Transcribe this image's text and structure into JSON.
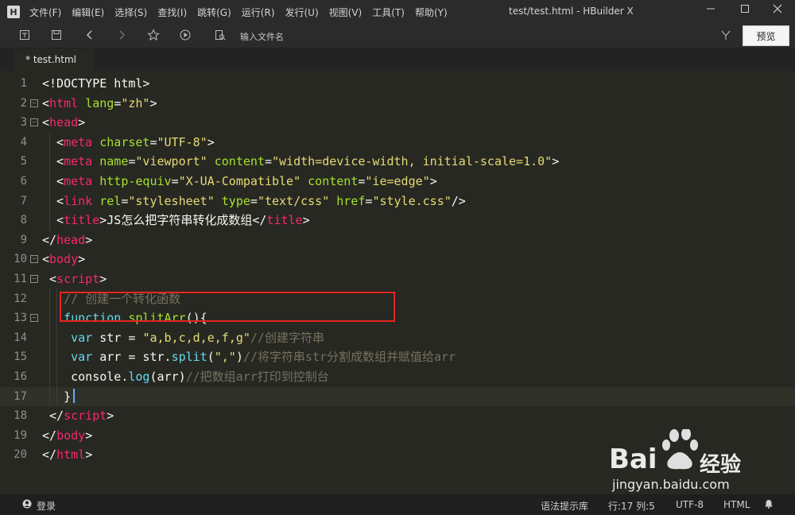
{
  "window": {
    "title": "test/test.html - HBuilder X",
    "logo": "H"
  },
  "menu": [
    {
      "label": "文件(F)"
    },
    {
      "label": "编辑(E)"
    },
    {
      "label": "选择(S)"
    },
    {
      "label": "查找(I)"
    },
    {
      "label": "跳转(G)"
    },
    {
      "label": "运行(R)"
    },
    {
      "label": "发行(U)"
    },
    {
      "label": "视图(V)"
    },
    {
      "label": "工具(T)"
    },
    {
      "label": "帮助(Y)"
    }
  ],
  "toolbar": {
    "search_placeholder": "输入文件名",
    "preview_label": "预览"
  },
  "tabs": [
    {
      "label": "* test.html"
    }
  ],
  "editor": {
    "lines": [
      {
        "num": "1"
      },
      {
        "num": "2"
      },
      {
        "num": "3"
      },
      {
        "num": "4"
      },
      {
        "num": "5"
      },
      {
        "num": "6"
      },
      {
        "num": "7"
      },
      {
        "num": "8"
      },
      {
        "num": "9"
      },
      {
        "num": "10"
      },
      {
        "num": "11"
      },
      {
        "num": "12"
      },
      {
        "num": "13"
      },
      {
        "num": "14"
      },
      {
        "num": "15"
      },
      {
        "num": "16"
      },
      {
        "num": "17"
      },
      {
        "num": "18"
      },
      {
        "num": "19"
      },
      {
        "num": "20"
      }
    ],
    "tokens": {
      "l1": [
        "<!DOCTYPE html>"
      ],
      "l2": [
        "<",
        "html",
        " ",
        "lang",
        "=",
        "\"zh\"",
        ">"
      ],
      "l3": [
        "<",
        "head",
        ">"
      ],
      "l4": [
        "  <",
        "meta",
        " ",
        "charset",
        "=",
        "\"UTF-8\"",
        ">"
      ],
      "l5": [
        "  <",
        "meta",
        " ",
        "name",
        "=",
        "\"viewport\"",
        " ",
        "content",
        "=",
        "\"width=device-width, initial-scale=1.0\"",
        ">"
      ],
      "l6": [
        "  <",
        "meta",
        " ",
        "http-equiv",
        "=",
        "\"X-UA-Compatible\"",
        " ",
        "content",
        "=",
        "\"ie=edge\"",
        ">"
      ],
      "l7": [
        "  <",
        "link",
        " ",
        "rel",
        "=",
        "\"stylesheet\"",
        " ",
        "type",
        "=",
        "\"text/css\"",
        " ",
        "href",
        "=",
        "\"style.css\"",
        "/>"
      ],
      "l8": [
        "  <",
        "title",
        ">",
        "JS怎么把字符串转化成数组",
        "</",
        "title",
        ">"
      ],
      "l9": [
        "</",
        "head",
        ">"
      ],
      "l10": [
        "<",
        "body",
        ">"
      ],
      "l11": [
        " <",
        "script",
        ">"
      ],
      "l12": [
        "   // 创建一个转化函数"
      ],
      "l13": [
        "   ",
        "function",
        " ",
        "splitArr",
        "(){"
      ],
      "l14": [
        "    ",
        "var",
        " str = ",
        "\"a,b,c,d,e,f,g\"",
        "//创建字符串"
      ],
      "l15": [
        "    ",
        "var",
        " arr = str.",
        "split",
        "(",
        "\",\"",
        ")",
        "//将字符串str分割成数组并赋值给arr"
      ],
      "l16": [
        "    console.",
        "log",
        "(arr)",
        "//把数组arr打印到控制台"
      ],
      "l17": [
        "   }"
      ],
      "l18": [
        " </",
        "script",
        ">"
      ],
      "l19": [
        "</",
        "body",
        ">"
      ],
      "l20": [
        "</",
        "html",
        ">"
      ]
    }
  },
  "status": {
    "login": "登录",
    "syntax_hint": "语法提示库",
    "position": "行:17  列:5",
    "encoding": "UTF-8",
    "language": "HTML"
  },
  "watermark": {
    "brand": "Bai",
    "brand2": "经验",
    "url": "jingyan.baidu.com"
  },
  "colors": {
    "bg": "#272822",
    "tag": "#f92672",
    "attr": "#a6e22e",
    "string": "#e6db74",
    "comment": "#75715e",
    "keyword": "#66d9ef",
    "highlight_box": "#e52520"
  }
}
